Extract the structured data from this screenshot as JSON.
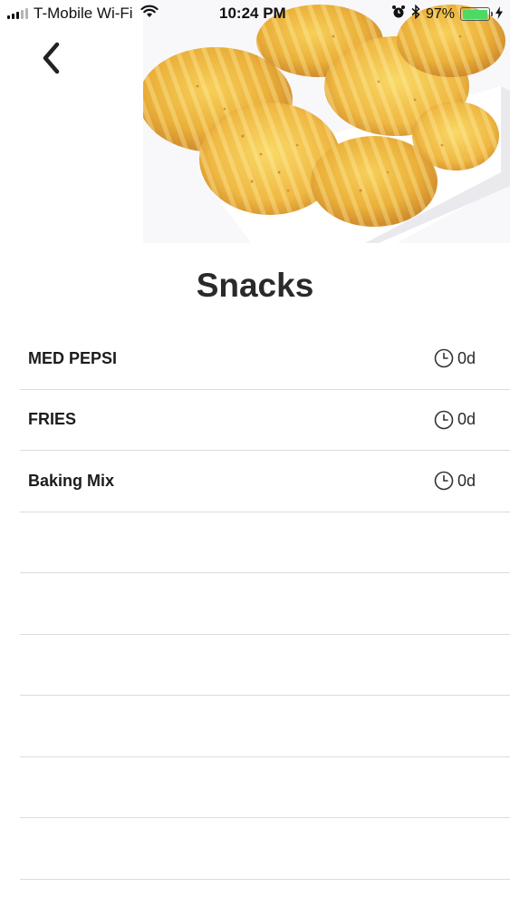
{
  "status_bar": {
    "carrier": "T-Mobile Wi-Fi",
    "time": "10:24 PM",
    "battery_percent": "97%",
    "battery_level": 0.97,
    "icons": [
      "cellular-signal-icon",
      "wifi-icon",
      "alarm-icon",
      "bluetooth-icon",
      "battery-icon",
      "charging-bolt-icon"
    ]
  },
  "nav": {
    "back_icon": "chevron-left-icon"
  },
  "header_image": {
    "subject": "potato-chips-photo"
  },
  "page": {
    "title": "Snacks"
  },
  "items": [
    {
      "name": "MED PEPSI",
      "age": "0d",
      "icon": "clock-icon"
    },
    {
      "name": "FRIES",
      "age": "0d",
      "icon": "clock-icon"
    },
    {
      "name": "Baking Mix",
      "age": "0d",
      "icon": "clock-icon"
    }
  ],
  "empty_row_count": 6
}
